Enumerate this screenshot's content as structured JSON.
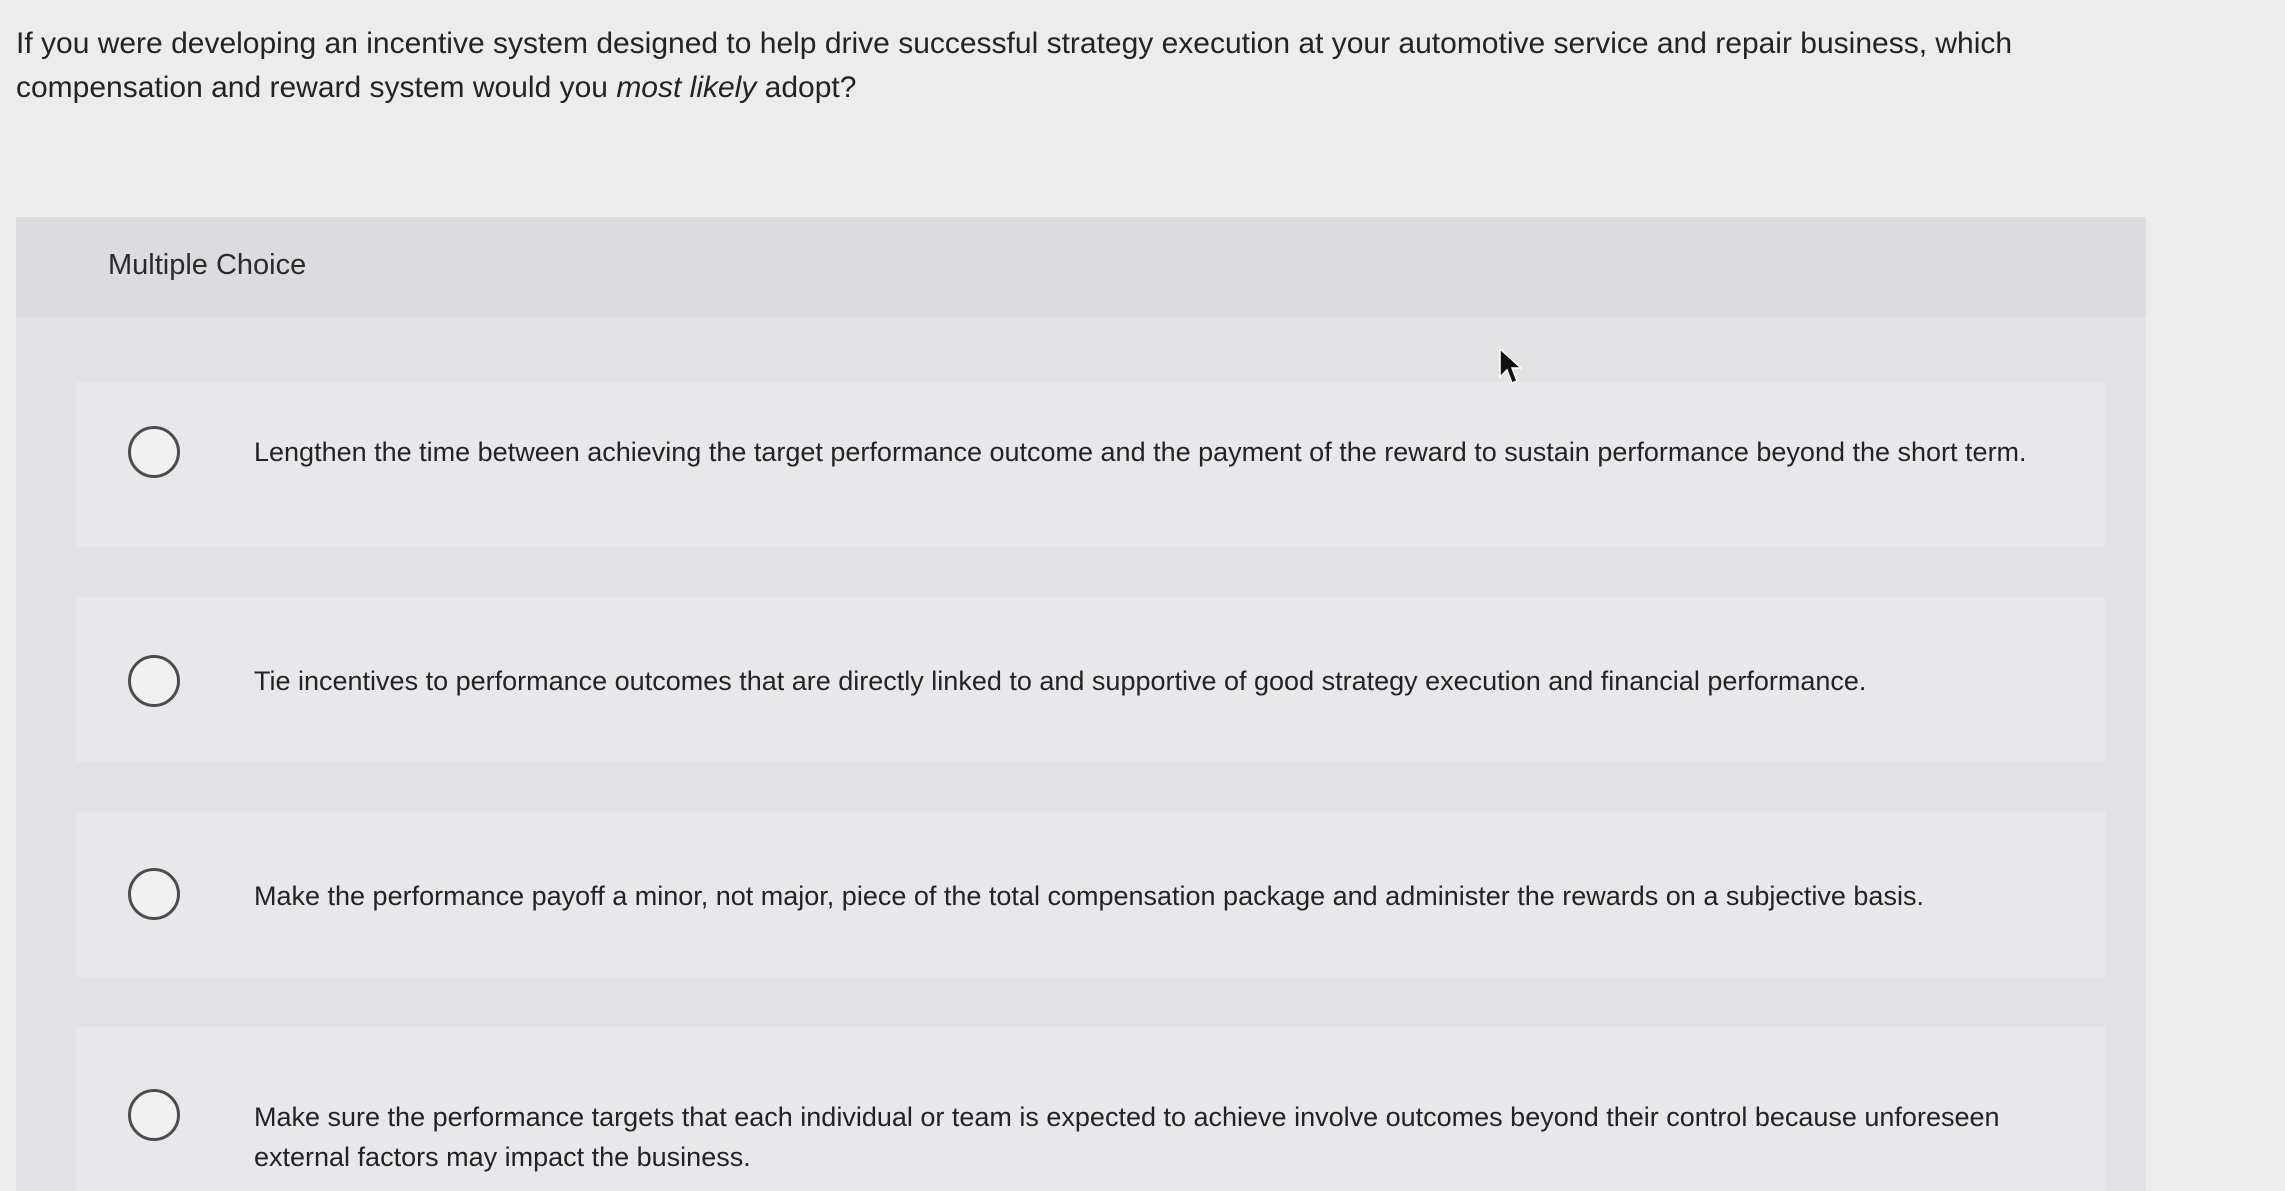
{
  "question": {
    "text_before": "If you were developing an incentive system designed to help drive successful strategy execution at your automotive service and repair business, which compensation and reward system would you ",
    "emphasis": "most likely",
    "text_after": " adopt?"
  },
  "multiple_choice": {
    "label": "Multiple Choice",
    "options": [
      {
        "text": "Lengthen the time between achieving the target performance outcome and the payment of the reward to sustain performance beyond the short term.",
        "selected": false
      },
      {
        "text": "Tie incentives to performance outcomes that are directly linked to and supportive of good strategy execution and financial performance.",
        "selected": false
      },
      {
        "text": "Make the performance payoff a minor, not major, piece of the total compensation package and administer the rewards on a subjective basis.",
        "selected": false
      },
      {
        "text": "Make sure the performance targets that each individual or team is expected to achieve involve outcomes beyond their control because unforeseen external factors may impact the business.",
        "selected": false
      }
    ]
  },
  "icons": {
    "radio": "radio-button-icon",
    "cursor": "mouse-pointer-icon"
  },
  "colors": {
    "background": "#ececed",
    "panel": "#e3e3e5",
    "radio_border": "#4b4c4f",
    "text": "#222325"
  }
}
